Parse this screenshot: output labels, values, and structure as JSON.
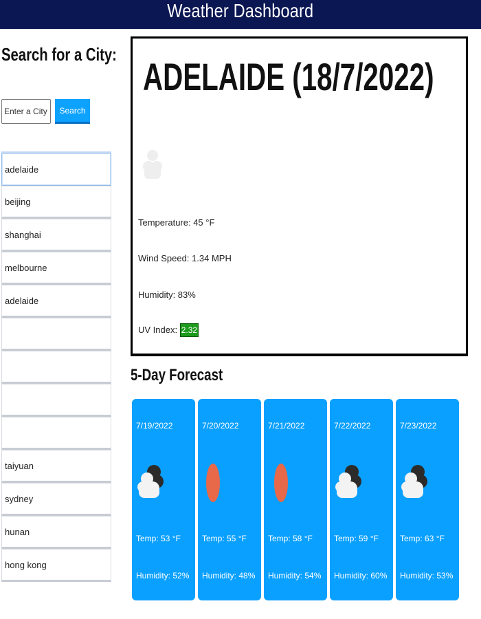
{
  "header": {
    "title": "Weather Dashboard"
  },
  "sidebar": {
    "title": "Search for a City:",
    "input": {
      "placeholder": "Enter a City",
      "value": ""
    },
    "search_button": "Search",
    "history": [
      "adelaide",
      "beijing",
      "shanghai",
      "melbourne",
      "adelaide",
      "",
      "",
      "",
      "",
      "taiyuan",
      "sydney",
      "hunan",
      "hong kong"
    ]
  },
  "current": {
    "city_date": "ADELAIDE (18/7/2022)",
    "icon": "cloud-icon",
    "temperature": "Temperature: 45 °F",
    "wind": "Wind Speed: 1.34 MPH",
    "humidity": "Humidity: 83%",
    "uv_label": "UV Index: ",
    "uv_value": "2.32",
    "uv_color": "#1c9a1c"
  },
  "forecast": {
    "title": "5-Day Forecast",
    "days": [
      {
        "date": "7/19/2022",
        "icon": "cloud-icon",
        "temp": "Temp: 53 °F",
        "humidity": "Humidity: 52%"
      },
      {
        "date": "7/20/2022",
        "icon": "sun-icon",
        "temp": "Temp: 55 °F",
        "humidity": "Humidity: 48%"
      },
      {
        "date": "7/21/2022",
        "icon": "sun-icon",
        "temp": "Temp: 58 °F",
        "humidity": "Humidity: 54%"
      },
      {
        "date": "7/22/2022",
        "icon": "cloud-icon",
        "temp": "Temp: 59 °F",
        "humidity": "Humidity: 60%"
      },
      {
        "date": "7/23/2022",
        "icon": "cloud-icon",
        "temp": "Temp: 63 °F",
        "humidity": "Humidity: 53%"
      }
    ]
  },
  "colors": {
    "header_bg": "#0a1752",
    "accent": "#0aa0ff",
    "sun": "#e8684a"
  }
}
